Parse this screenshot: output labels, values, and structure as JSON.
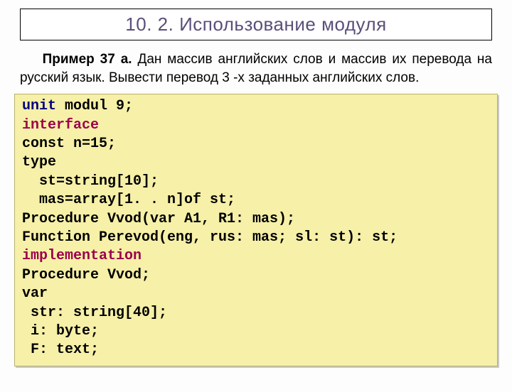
{
  "heading": "10. 2. Использование модуля",
  "intro": {
    "label": "Пример 37 а.",
    "text": "  Дан массив английских слов и массив их перевода на русский язык. Вывести перевод 3 -х заданных английских слов."
  },
  "code": {
    "l01a": "unit",
    "l01b": " modul 9;",
    "l02": "interface",
    "l03": "const n=15;",
    "l04": "type",
    "l05": "  st=string[10];",
    "l06": "  mas=array[1. . n]of st;",
    "l07": "Procedure Vvod(var A1, R1: mas);",
    "l08": "Function Perevod(eng, rus: mas; sl: st): st;",
    "l09": "implementation",
    "l10": "Procedure Vvod;",
    "l11": "var",
    "l12": " str: string[40];",
    "l13": " i: byte;",
    "l14": " F: text;"
  }
}
